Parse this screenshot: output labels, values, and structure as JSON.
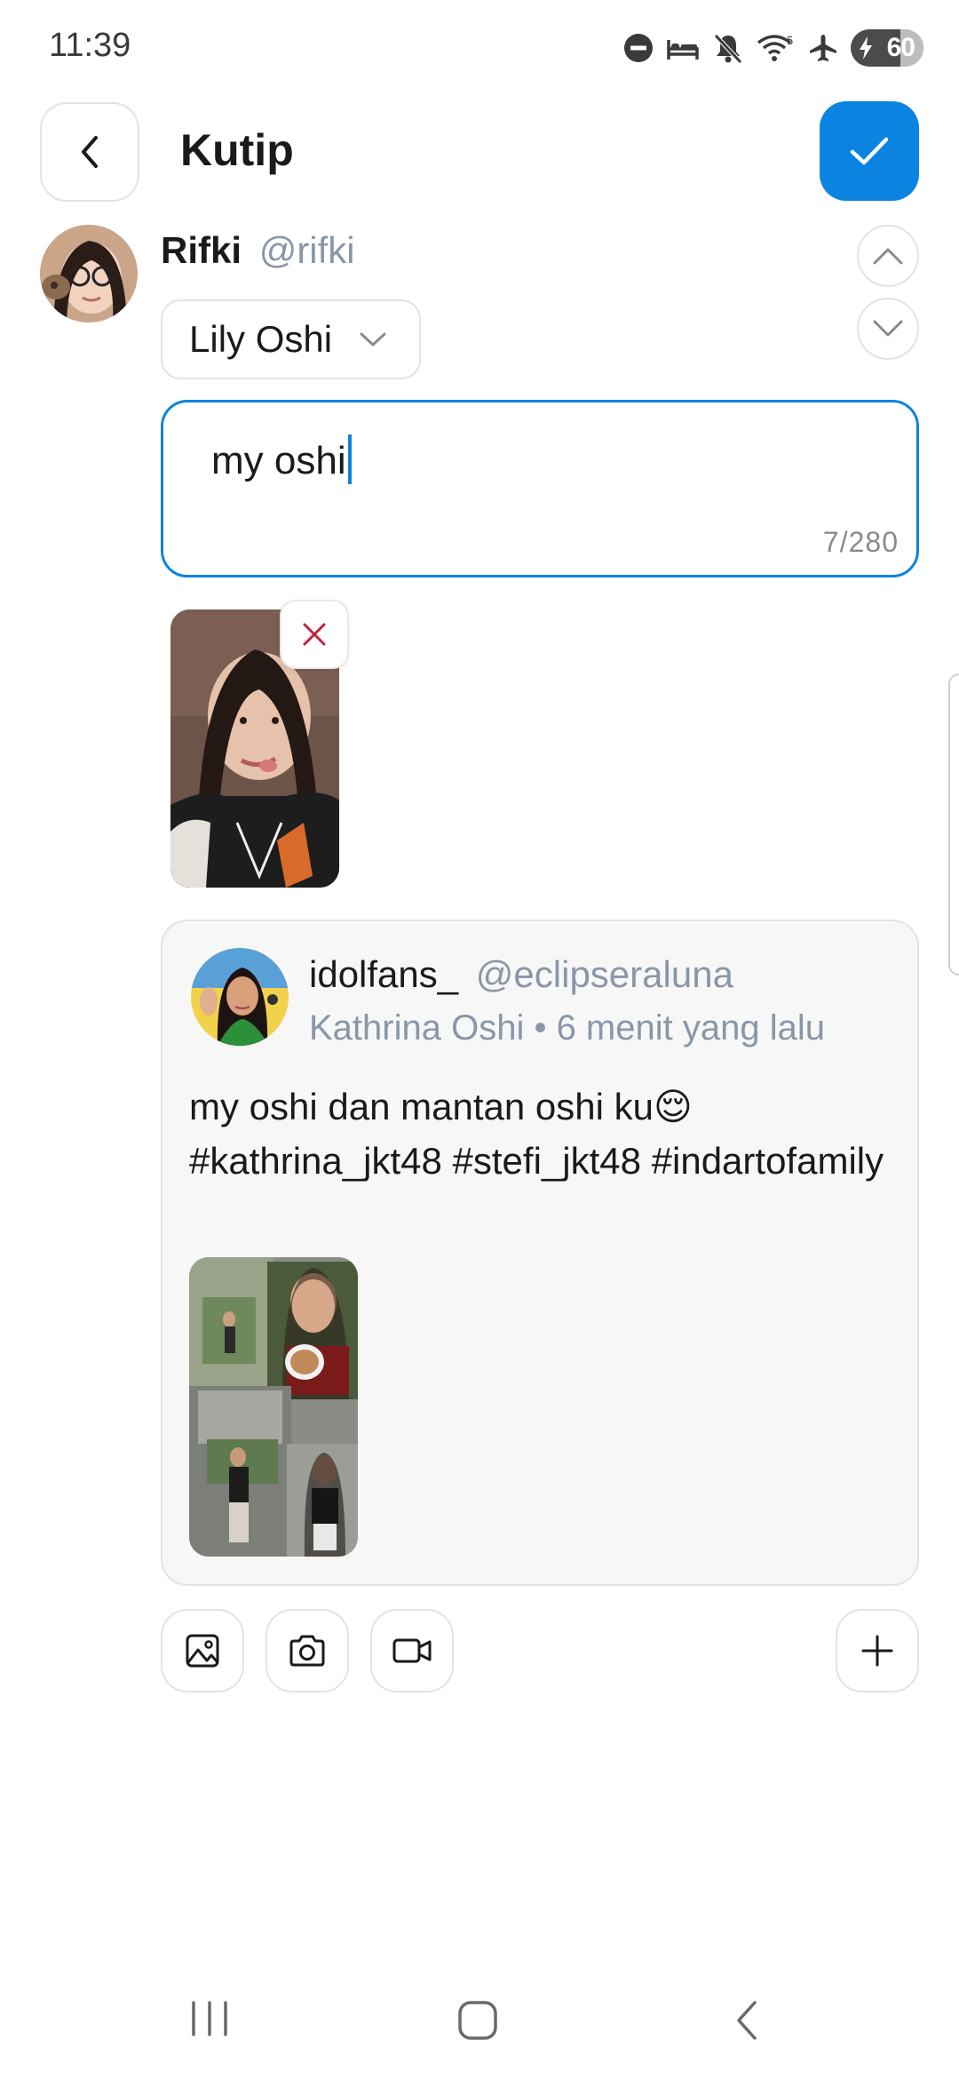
{
  "status_bar": {
    "time": "11:39",
    "battery_percent": "60",
    "icons": [
      "do-not-disturb-icon",
      "sleep-icon",
      "mute-icon",
      "wifi-icon",
      "airplane-icon",
      "battery-icon"
    ]
  },
  "header": {
    "title": "Kutip",
    "back_icon": "chevron-left-icon",
    "confirm_icon": "check-icon",
    "accent_color": "#0a84e0"
  },
  "composer": {
    "user_name": "Rifki",
    "user_handle": "@rifki",
    "community_selected": "Lily Oshi",
    "text_value": "my oshi",
    "char_count": "7/280"
  },
  "quoted_post": {
    "user_name": "idolfans_",
    "user_handle": "@eclipseraluna",
    "meta": "Kathrina Oshi • 6 menit yang lalu",
    "text": "my oshi dan mantan oshi ku😌 #kathrina_jkt48 #stefi_jkt48 #indartofamily"
  },
  "toolbar": {
    "icons": [
      "image-icon",
      "camera-icon",
      "video-icon",
      "plus-icon"
    ]
  },
  "system_nav": {
    "icons": [
      "recent-apps-icon",
      "home-icon",
      "back-icon"
    ]
  }
}
